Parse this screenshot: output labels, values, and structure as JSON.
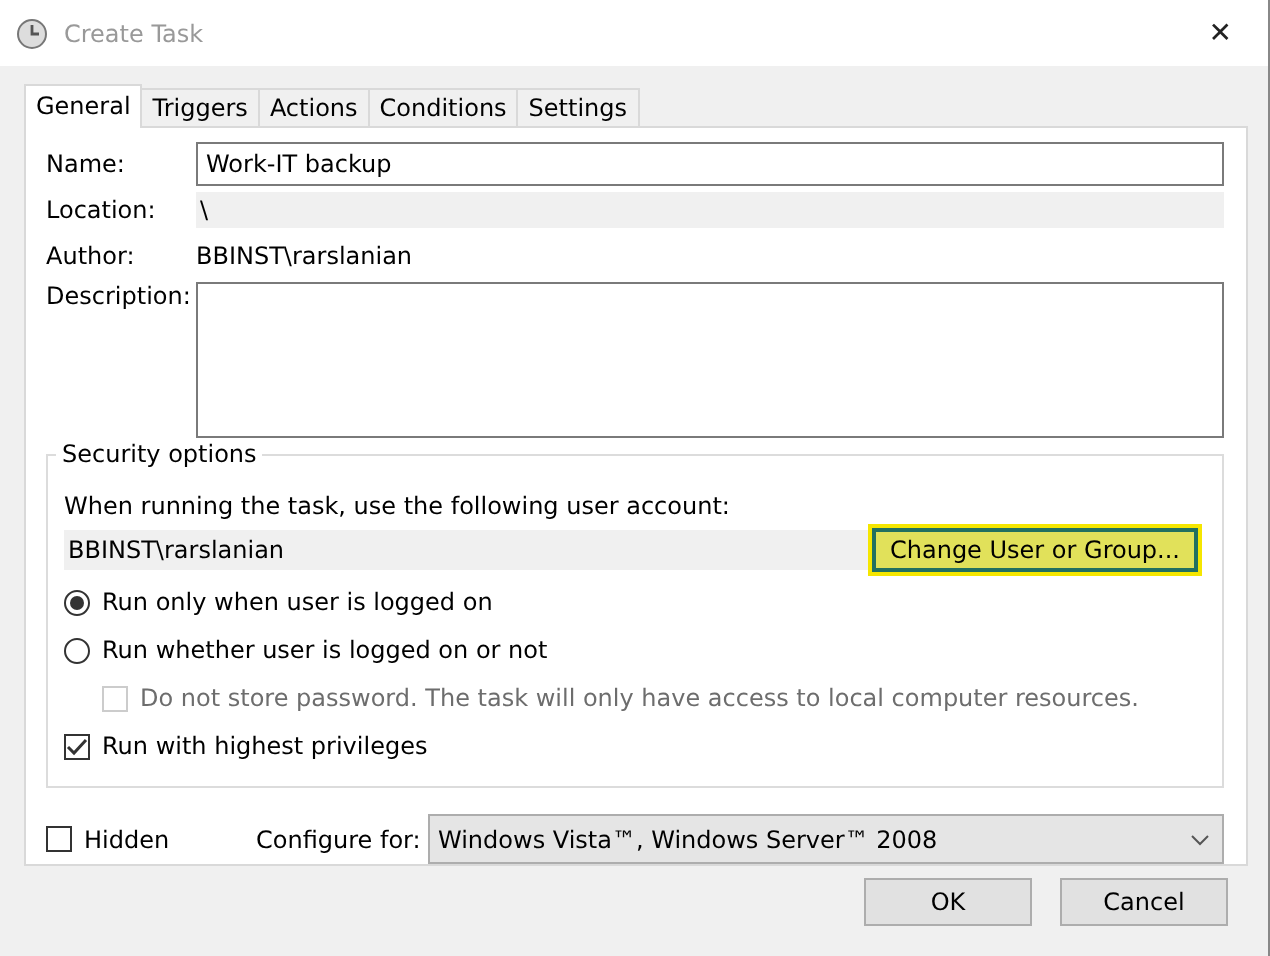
{
  "window": {
    "title": "Create Task",
    "close": "✕"
  },
  "tabs": [
    {
      "label": "General",
      "selected": true
    },
    {
      "label": "Triggers",
      "selected": false
    },
    {
      "label": "Actions",
      "selected": false
    },
    {
      "label": "Conditions",
      "selected": false
    },
    {
      "label": "Settings",
      "selected": false
    }
  ],
  "general": {
    "name_label": "Name:",
    "name_value": "Work-IT backup",
    "location_label": "Location:",
    "location_value": "\\",
    "author_label": "Author:",
    "author_value": "BBINST\\rarslanian",
    "description_label": "Description:"
  },
  "security": {
    "title": "Security options",
    "account_prompt": "When running the task, use the following user account:",
    "account": "BBINST\\rarslanian",
    "change_button": "Change User or Group...",
    "options": [
      {
        "kind": "radio",
        "label": "Run only when user is logged on",
        "checked": true,
        "disabled": false,
        "indent": false
      },
      {
        "kind": "radio",
        "label": "Run whether user is logged on or not",
        "checked": false,
        "disabled": false,
        "indent": false
      },
      {
        "kind": "checkbox",
        "label": "Do not store password.  The task will only have access to local computer resources.",
        "checked": false,
        "disabled": true,
        "indent": true
      },
      {
        "kind": "checkbox",
        "label": "Run with highest privileges",
        "checked": true,
        "disabled": false,
        "indent": false
      }
    ]
  },
  "hidden": {
    "label": "Hidden",
    "checked": false
  },
  "configure": {
    "label": "Configure for:",
    "value": "Windows Vista™, Windows Server™ 2008"
  },
  "buttons": [
    "OK",
    "Cancel"
  ]
}
